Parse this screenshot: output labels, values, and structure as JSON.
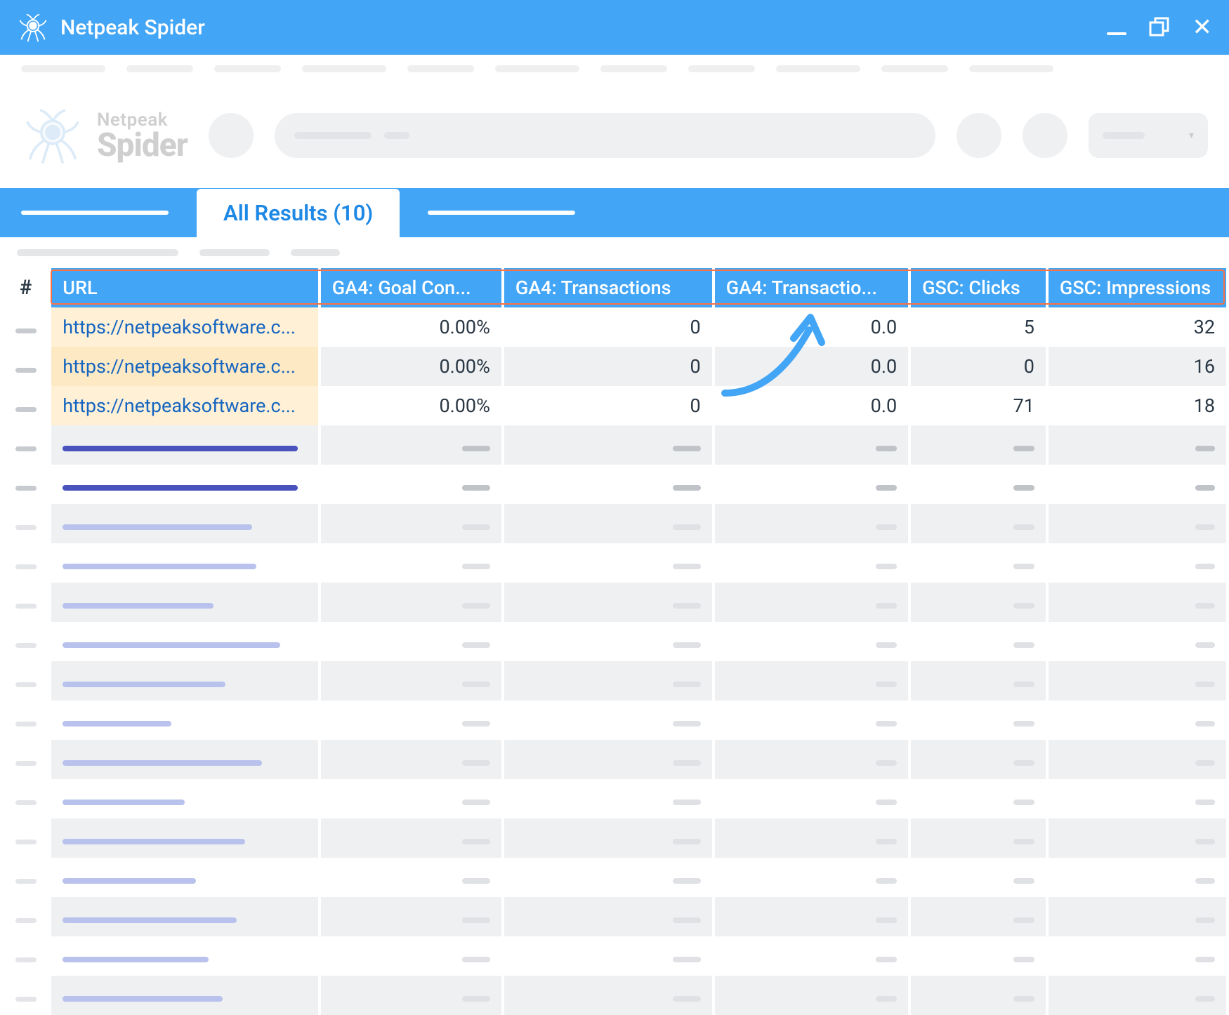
{
  "titlebar": {
    "appName": "Netpeak Spider"
  },
  "logo": {
    "top": "Netpeak",
    "bottom": "Spider"
  },
  "tabs": {
    "activeLabel": "All Results (10)"
  },
  "columns": {
    "idx": "#",
    "url": "URL",
    "ga4Goal": "GA4: Goal Con...",
    "ga4Tx": "GA4: Transactions",
    "ga4Tx2": "GA4: Transactio...",
    "gscClicks": "GSC: Clicks",
    "gscImpr": "GSC: Impressions"
  },
  "rows": [
    {
      "url": "https://netpeaksoftware.c...",
      "ga4Goal": "0.00%",
      "ga4Tx": "0",
      "ga4Tx2": "0.0",
      "gscClicks": "5",
      "gscImpr": "32"
    },
    {
      "url": "https://netpeaksoftware.c...",
      "ga4Goal": "0.00%",
      "ga4Tx": "0",
      "ga4Tx2": "0.0",
      "gscClicks": "0",
      "gscImpr": "16"
    },
    {
      "url": "https://netpeaksoftware.c...",
      "ga4Goal": "0.00%",
      "ga4Tx": "0",
      "ga4Tx2": "0.0",
      "gscClicks": "71",
      "gscImpr": "18"
    }
  ],
  "placeholderRows": [
    {
      "urlW": 335,
      "urlColor": "c-darkblue",
      "barColor": "c-gray",
      "odd": false,
      "idx": "dark"
    },
    {
      "urlW": 335,
      "urlColor": "c-darkblue",
      "barColor": "c-gray",
      "odd": true,
      "idx": "dark"
    },
    {
      "urlW": 270,
      "urlColor": "c-lightblue",
      "barColor": "c-litegray",
      "odd": false,
      "idx": "light"
    },
    {
      "urlW": 276,
      "urlColor": "c-lightblue",
      "barColor": "c-litegray",
      "odd": true,
      "idx": "light"
    },
    {
      "urlW": 215,
      "urlColor": "c-lightblue",
      "barColor": "c-litegray",
      "odd": false,
      "idx": "light"
    },
    {
      "urlW": 310,
      "urlColor": "c-lightblue",
      "barColor": "c-litegray",
      "odd": true,
      "idx": "light"
    },
    {
      "urlW": 232,
      "urlColor": "c-lightblue",
      "barColor": "c-litegray",
      "odd": false,
      "idx": "light"
    },
    {
      "urlW": 155,
      "urlColor": "c-lightblue",
      "barColor": "c-litegray",
      "odd": true,
      "idx": "light"
    },
    {
      "urlW": 284,
      "urlColor": "c-lightblue",
      "barColor": "c-litegray",
      "odd": false,
      "idx": "light"
    },
    {
      "urlW": 174,
      "urlColor": "c-lightblue",
      "barColor": "c-litegray",
      "odd": true,
      "idx": "light"
    },
    {
      "urlW": 260,
      "urlColor": "c-lightblue",
      "barColor": "c-litegray",
      "odd": false,
      "idx": "light"
    },
    {
      "urlW": 190,
      "urlColor": "c-lightblue",
      "barColor": "c-litegray",
      "odd": true,
      "idx": "light"
    },
    {
      "urlW": 248,
      "urlColor": "c-lightblue",
      "barColor": "c-litegray",
      "odd": false,
      "idx": "light"
    },
    {
      "urlW": 208,
      "urlColor": "c-lightblue",
      "barColor": "c-litegray",
      "odd": true,
      "idx": "light"
    },
    {
      "urlW": 228,
      "urlColor": "c-lightblue",
      "barColor": "c-litegray",
      "odd": false,
      "idx": "light"
    }
  ]
}
